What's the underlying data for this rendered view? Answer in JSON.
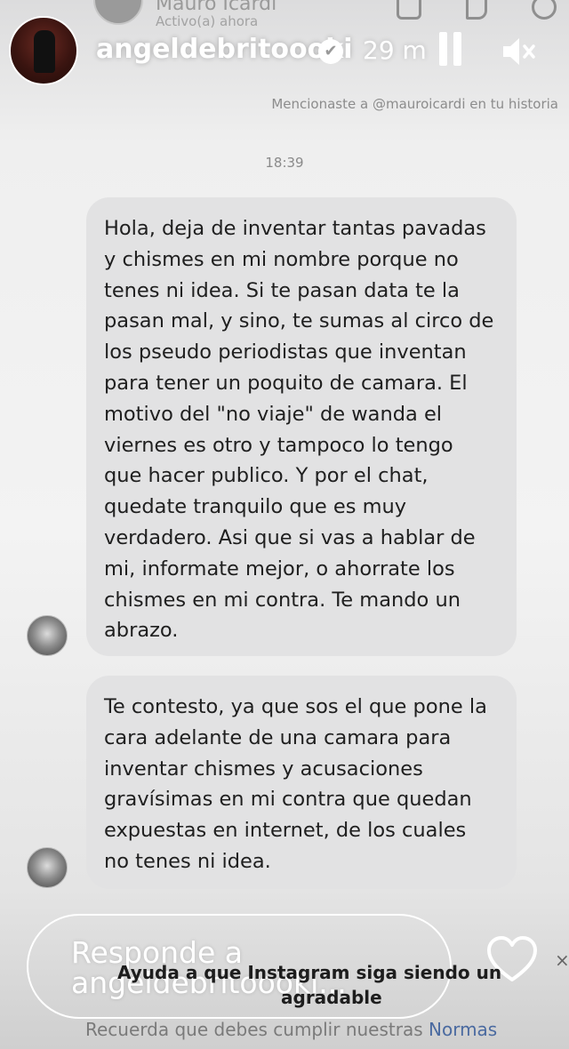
{
  "dm_header": {
    "name": "Mauro Icardi",
    "status": "Activo(a) ahora"
  },
  "story": {
    "username": "angeldebritoooki",
    "time_ago": "29 m",
    "verified_icon": "verified-check-icon",
    "pause_icon": "pause-icon",
    "mute_icon": "speaker-muted-icon"
  },
  "chat": {
    "mention_notice": "Mencionaste a @mauroicardi en tu historia",
    "timestamp": "18:39",
    "messages": [
      {
        "text": "Hola, deja de inventar tantas pavadas\ny chismes en mi nombre porque no\ntenes ni idea. Si te pasan data te la\npasan mal, y sino, te sumas al circo de\nlos pseudo periodistas que inventan\npara tener un poquito de camara. El\nmotivo del \"no viaje\" de wanda el\nviernes es otro y tampoco lo tengo\nque hacer publico. Y por el chat,\nquedate tranquilo que es muy\nverdadero. Asi que si vas a hablar de\nmi, informate mejor, o ahorrate los\nchismes en mi contra. Te mando un\nabrazo."
      },
      {
        "text": "Te contesto, ya que sos el que pone la\ncara adelante de una camara para\ninventar chismes y acusaciones\ngravísimas en mi contra que quedan\nexpuestas en internet, de los cuales\nno tenes ni idea."
      }
    ]
  },
  "reply": {
    "placeholder": "Responde a angeldebritoooki...",
    "heart_icon": "heart-icon"
  },
  "overlay": {
    "line1": "Ayuda a que Instagram siga siendo un",
    "line2": "agradable",
    "line3_prefix": "Recuerda que debes cumplir nuestras",
    "line3_link": "Normas"
  }
}
